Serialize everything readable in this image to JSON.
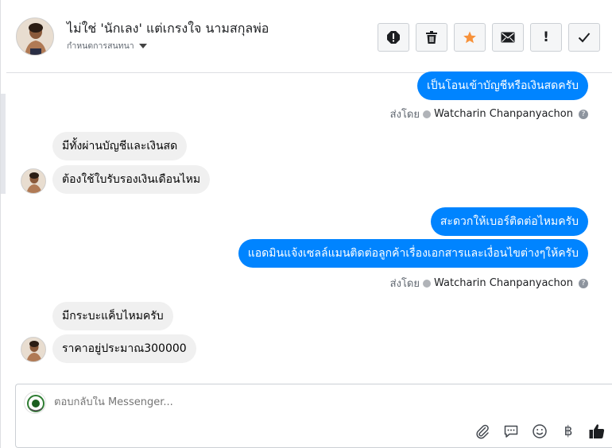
{
  "header": {
    "contact_name": "ไม่ใช่ 'นักเลง' แต่เกรงใจ นามสกุลพ่อ",
    "subtitle": "กำหนดการสนทนา",
    "actions": [
      "report-icon",
      "trash-icon",
      "star-icon",
      "envelope-icon",
      "exclamation-icon",
      "check-icon"
    ],
    "star_color": "#f7923b",
    "exclamation_label": "!"
  },
  "messages": {
    "m1": "เป็นโอนเข้าบัญชีหรือเงินสดครับ",
    "sent_by_1_prefix": "ส่งโดย",
    "sent_by_1_name": "Watcharin Chanpanyachon",
    "m2": "มีทั้งผ่านบัญชีและเงินสด",
    "m3": "ต้องใช้ใบรับรองเงินเดือนไหม",
    "m4": "สะดวกให้เบอร์ติดต่อไหมครับ",
    "m5": "แอดมินแจ้งเซลล์แมนติดต่อลูกค้าเรื่องเอกสารและเงื่อนไขต่างๆให้ครับ",
    "sent_by_2_prefix": "ส่งโดย",
    "sent_by_2_name": "Watcharin Chanpanyachon",
    "m6": "มีกระบะแค็บไหมครับ",
    "m7": "ราคาอยู่ประมาณ300000"
  },
  "composer": {
    "placeholder": "ตอบกลับใน Messenger...",
    "tools": [
      "paperclip-icon",
      "saved-replies-icon",
      "emoji-icon",
      "baht-icon",
      "thumbs-up-icon"
    ],
    "baht_symbol": "฿"
  },
  "colors": {
    "outgoing_bubble": "#0084ff",
    "incoming_bubble": "#f0f0f0"
  }
}
